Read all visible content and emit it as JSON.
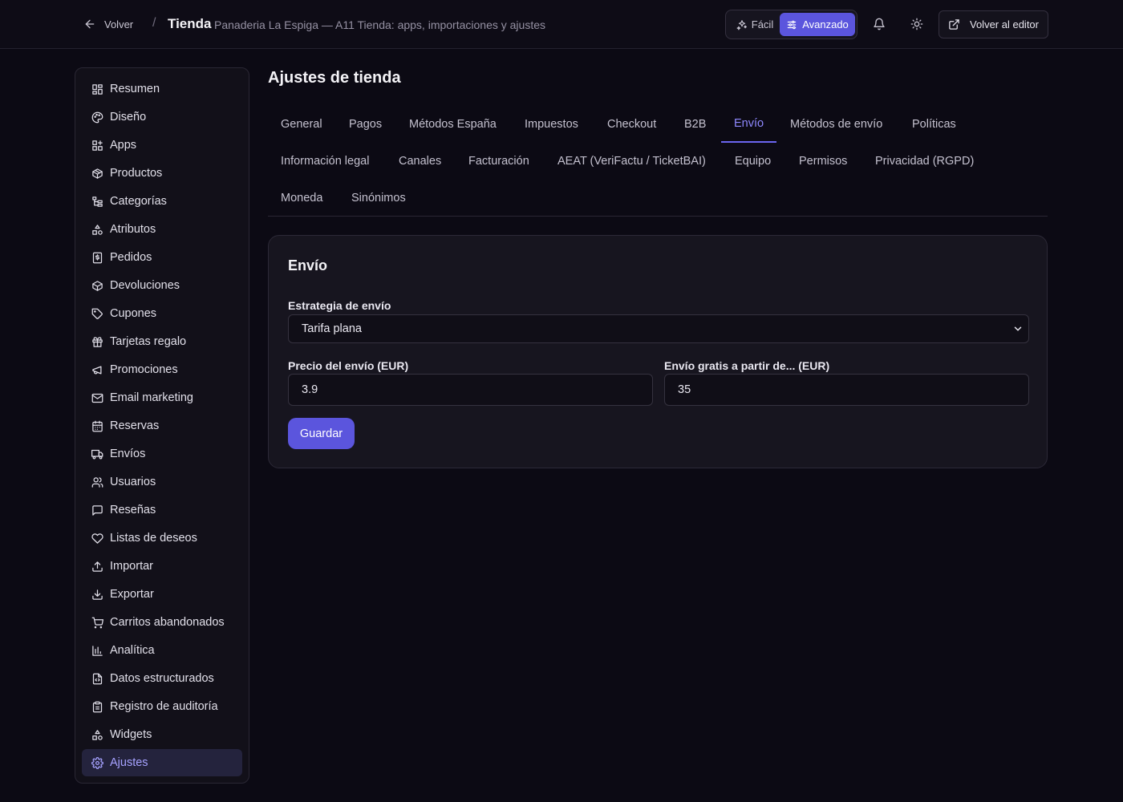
{
  "topbar": {
    "back_label": "Volver",
    "separator": "/",
    "title": "Tienda",
    "subtitle": "Panaderia La Espiga — A11 Tienda: apps, importaciones y ajustes",
    "mode_easy": "Fácil",
    "mode_advanced": "Avanzado",
    "editor_button": "Volver al editor"
  },
  "sidebar": {
    "items": [
      {
        "label": "Resumen",
        "icon": "dashboard-icon"
      },
      {
        "label": "Diseño",
        "icon": "palette-icon"
      },
      {
        "label": "Apps",
        "icon": "apps-icon"
      },
      {
        "label": "Productos",
        "icon": "package-icon"
      },
      {
        "label": "Categorías",
        "icon": "category-tree-icon"
      },
      {
        "label": "Atributos",
        "icon": "shapes-icon"
      },
      {
        "label": "Pedidos",
        "icon": "receipt-icon"
      },
      {
        "label": "Devoluciones",
        "icon": "package-return-icon"
      },
      {
        "label": "Cupones",
        "icon": "tag-icon"
      },
      {
        "label": "Tarjetas regalo",
        "icon": "gift-icon"
      },
      {
        "label": "Promociones",
        "icon": "megaphone-icon"
      },
      {
        "label": "Email marketing",
        "icon": "mail-icon"
      },
      {
        "label": "Reservas",
        "icon": "calendar-icon"
      },
      {
        "label": "Envíos",
        "icon": "truck-icon"
      },
      {
        "label": "Usuarios",
        "icon": "users-icon"
      },
      {
        "label": "Reseñas",
        "icon": "message-icon"
      },
      {
        "label": "Listas de deseos",
        "icon": "heart-icon"
      },
      {
        "label": "Importar",
        "icon": "upload-icon"
      },
      {
        "label": "Exportar",
        "icon": "download-icon"
      },
      {
        "label": "Carritos abandonados",
        "icon": "cart-icon"
      },
      {
        "label": "Analítica",
        "icon": "bar-chart-icon"
      },
      {
        "label": "Datos estructurados",
        "icon": "file-code-icon"
      },
      {
        "label": "Registro de auditoría",
        "icon": "clipboard-icon"
      },
      {
        "label": "Widgets",
        "icon": "shapes-icon"
      },
      {
        "label": "Ajustes",
        "icon": "gear-icon",
        "active": true
      }
    ]
  },
  "main": {
    "title": "Ajustes de tienda",
    "tabs": [
      "General",
      "Pagos",
      "Métodos España",
      "Impuestos",
      "Checkout",
      "B2B",
      "Envío",
      "Métodos de envío",
      "Políticas",
      "Información legal",
      "Canales",
      "Facturación",
      "AEAT (VeriFactu / TicketBAI)",
      "Equipo",
      "Permisos",
      "Privacidad (RGPD)",
      "Moneda",
      "Sinónimos"
    ],
    "active_tab": "Envío",
    "card": {
      "title": "Envío",
      "strategy_label": "Estrategia de envío",
      "strategy_value": "Tarifa plana",
      "price_label": "Precio del envío (EUR)",
      "price_value": "3.9",
      "free_label": "Envío gratis a partir de... (EUR)",
      "free_value": "35",
      "save_label": "Guardar"
    }
  },
  "colors": {
    "background": "#0c0a14",
    "accent": "#5b55dd",
    "active_tab_text": "#8f89ff",
    "active_sidebar_text": "#a6a2ff"
  }
}
